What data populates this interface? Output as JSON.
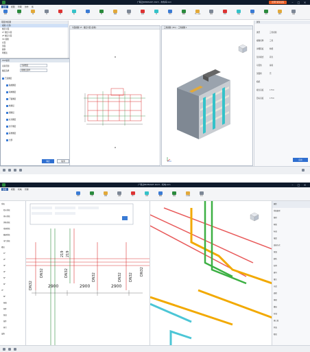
{
  "top": {
    "window_title": "广联达BIMMAKE 2023 - 构件库.bim",
    "badge": "立即升级专业版",
    "tabs": [
      "建模",
      "视图",
      "管理",
      "协作",
      "族"
    ],
    "tools": [
      "轴网",
      "标高",
      "墙",
      "柱",
      "梁",
      "板",
      "门",
      "窗",
      "楼梯",
      "坡道",
      "屋顶",
      "族",
      "构件",
      "翻模",
      "导入CAD",
      "链接",
      "剖切",
      "测量",
      "渲染",
      "漫游",
      "输出",
      "设置"
    ],
    "left_panel_title": "项目浏览器",
    "left_rows": [
      "视图 (全部)",
      "楼层平面",
      "1F 楼层平面",
      "2F 楼层平面",
      "3D 视图",
      "立面",
      "剖面",
      "图例",
      "明细表"
    ],
    "modal": {
      "title": "CAD识别",
      "label_scope": "识别范围",
      "value_scope": "当前楼层",
      "label_layer": "图层选择",
      "value_layer": "按图层选择",
      "rows": [
        "已选图层",
        "轴线图层",
        "墙体图层",
        "门窗图层",
        "柱图层",
        "梁图层",
        "标注图层",
        "文字图层",
        "其他图层",
        "全部"
      ],
      "ok": "确定",
      "cancel": "取消"
    },
    "view1_title": "平面视图 1F - 楼层平面 (建筑)",
    "view2_title": "三维视图 {3D} - 三维视图 1",
    "right_panel": {
      "title": "属性",
      "rows": [
        {
          "k": "类型",
          "v": "三维视图"
        },
        {
          "k": "视图名称",
          "v": "三维"
        },
        {
          "k": "详细程度",
          "v": "精细"
        },
        {
          "k": "显示模式",
          "v": "着色"
        },
        {
          "k": "可见性",
          "v": "编辑"
        },
        {
          "k": "剖面框",
          "v": "否"
        },
        {
          "k": "相机",
          "v": ""
        },
        {
          "k": "视点高度",
          "v": "1750"
        },
        {
          "k": "目标高度",
          "v": "1750"
        }
      ],
      "apply": "应用"
    }
  },
  "bottom": {
    "window_title": "广联达BIMMAKE 2023 - 机电.bim",
    "tabs": [
      "建模",
      "视图",
      "机电",
      "管理"
    ],
    "tools": [
      "风管",
      "水管",
      "桥架",
      "设备",
      "阀门",
      "连接",
      "翻模",
      "碰撞",
      "支吊架",
      "标注"
    ],
    "pipe_labels": [
      "DN32",
      "DN32",
      "DN32",
      "DN32",
      "DN32",
      "DN32",
      "DN32"
    ],
    "dims": [
      "2900",
      "2900",
      "2900"
    ],
    "vertical_numbers": [
      "219",
      "219"
    ],
    "left_rows": [
      "系统",
      "给水系统",
      "排水系统",
      "消防系统",
      "喷淋系统",
      "暖通系统",
      "电气系统",
      "楼层",
      "1F",
      "2F",
      "3F",
      "4F",
      "5F",
      "6F",
      "7F",
      "8F",
      "屋面",
      "构件",
      "管道",
      "管件",
      "阀门",
      "设备"
    ],
    "right_rows": [
      "属性",
      "系统类型",
      "管径",
      "材质",
      "标高",
      "坡度",
      "连接方式",
      "保温",
      "颜色",
      "名称",
      "编号",
      "备注",
      "长度",
      "面积",
      "体积",
      "楼层",
      "区域",
      "施工段",
      "状态",
      "阶段"
    ]
  }
}
